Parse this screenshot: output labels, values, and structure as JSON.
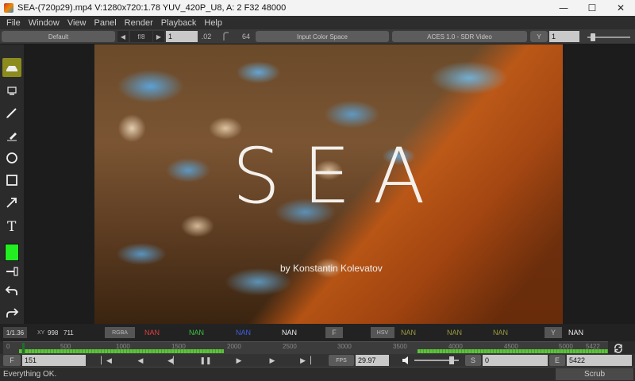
{
  "window": {
    "title": "SEA-(720p29).mp4  V:1280x720:1.78 YUV_420P_U8, A: 2 F32 48000",
    "minimize": "—",
    "maximize": "☐",
    "close": "✕"
  },
  "menu": [
    "File",
    "Window",
    "View",
    "Panel",
    "Render",
    "Playback",
    "Help"
  ],
  "toolbar": {
    "layout": "Default",
    "fstop": "f/8",
    "exposure": "1",
    "gamma_small": ".02",
    "bits": "64",
    "input_color_space": "Input Color Space",
    "display_view": "ACES 1.0 - SDR Video",
    "channel": "Y",
    "gain": "1"
  },
  "video": {
    "title": "SEA",
    "credit": "by Konstantin Kolevatov"
  },
  "info": {
    "zoom": "1/1.36",
    "xy_label": "XY",
    "x": "998",
    "y": "711",
    "rgba_label": "RGBA",
    "r": "NAN",
    "g": "NAN",
    "b": "NAN",
    "a": "NAN",
    "f_label": "F",
    "hsv_label": "HSV",
    "h": "NAN",
    "s": "NAN",
    "v": "NAN",
    "y_label": "Y",
    "y_val": "NAN"
  },
  "timeline": {
    "labels": [
      "0",
      "500",
      "1000",
      "1500",
      "2000",
      "2500",
      "3000",
      "3500",
      "4000",
      "4500",
      "5000",
      "5422"
    ]
  },
  "playback": {
    "frame_label": "F",
    "frame": "151",
    "fps_label": "FPS",
    "fps": "29.97",
    "start_label": "S",
    "start": "0",
    "end_label": "E",
    "end": "5422"
  },
  "status": {
    "message": "Everything OK.",
    "scrub": "Scrub"
  },
  "colors": {
    "draw_color": "#22ee22",
    "active_tool": "#8b8b1e"
  }
}
